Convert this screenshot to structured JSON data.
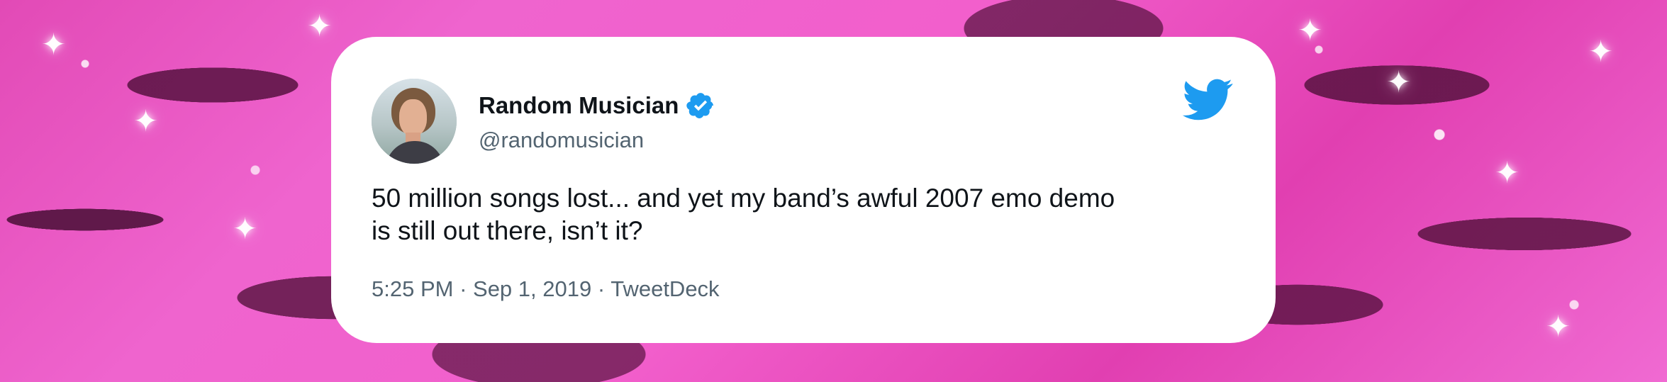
{
  "tweet": {
    "name": "Random Musician",
    "handle": "@randomusician",
    "text_lines": [
      "50 million songs lost... and yet my band’s awful 2007 emo demo",
      "is still out there, isn’t it?"
    ],
    "time": "5:25 PM",
    "separator1": " · ",
    "date": "Sep 1, 2019",
    "separator2": " · ",
    "source": "TweetDeck"
  },
  "icons": {
    "verified": "verified-badge-icon",
    "brand": "twitter-bird-icon"
  },
  "colors": {
    "brand_blue": "#1d9bf0",
    "primary_text": "#0f1419",
    "secondary_text": "#536471",
    "card_background": "#ffffff"
  }
}
